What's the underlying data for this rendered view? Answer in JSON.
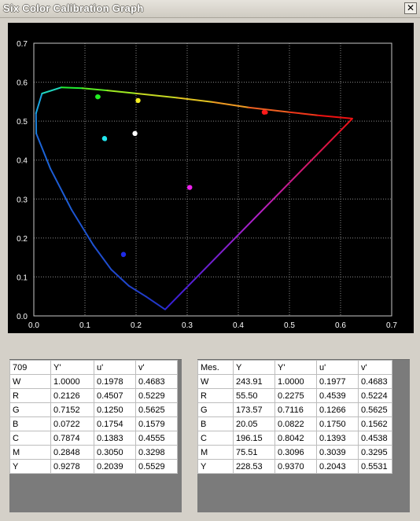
{
  "window": {
    "title": "Six Color Calibration Graph",
    "close_glyph": "✕"
  },
  "chart_data": {
    "type": "scatter",
    "title": "",
    "xlabel": "",
    "ylabel": "",
    "xlim": [
      0.0,
      0.7
    ],
    "ylim": [
      0.0,
      0.7
    ],
    "x_ticks": [
      "0.0",
      "0.1",
      "0.2",
      "0.3",
      "0.4",
      "0.5",
      "0.6",
      "0.7"
    ],
    "y_ticks": [
      "0.0",
      "0.1",
      "0.2",
      "0.3",
      "0.4",
      "0.5",
      "0.6",
      "0.7"
    ],
    "grid": true,
    "background": "#000000",
    "gamut_triangle": {
      "R": [
        0.4507,
        0.5229
      ],
      "G": [
        0.125,
        0.5625
      ],
      "B": [
        0.1754,
        0.1579
      ]
    },
    "spectral_locus": [
      [
        0.2568,
        0.0165
      ],
      [
        0.2196,
        0.0495
      ],
      [
        0.1859,
        0.0771
      ],
      [
        0.1516,
        0.1187
      ],
      [
        0.1165,
        0.1816
      ],
      [
        0.0737,
        0.2729
      ],
      [
        0.0325,
        0.3778
      ],
      [
        0.0048,
        0.4681
      ],
      [
        0.0043,
        0.5203
      ],
      [
        0.016,
        0.5709
      ],
      [
        0.054,
        0.5866
      ],
      [
        0.095,
        0.5845
      ],
      [
        0.1437,
        0.5788
      ],
      [
        0.2,
        0.5711
      ],
      [
        0.28,
        0.56
      ],
      [
        0.35,
        0.549
      ],
      [
        0.42,
        0.535
      ],
      [
        0.5,
        0.523
      ],
      [
        0.555,
        0.515
      ],
      [
        0.623,
        0.5065
      ]
    ],
    "series": [
      {
        "name": "709",
        "points": [
          {
            "label": "W",
            "u": 0.1978,
            "v": 0.4683,
            "color": "#ffffff"
          },
          {
            "label": "R",
            "u": 0.4507,
            "v": 0.5229,
            "color": "#ff1a1a"
          },
          {
            "label": "G",
            "u": 0.125,
            "v": 0.5625,
            "color": "#22ee22"
          },
          {
            "label": "B",
            "u": 0.1754,
            "v": 0.1579,
            "color": "#1f2be6"
          },
          {
            "label": "C",
            "u": 0.1383,
            "v": 0.4555,
            "color": "#22e6ee"
          },
          {
            "label": "M",
            "u": 0.305,
            "v": 0.3298,
            "color": "#ee22ee"
          },
          {
            "label": "Y",
            "u": 0.2039,
            "v": 0.5529,
            "color": "#f4ee22"
          }
        ]
      },
      {
        "name": "Mes.",
        "points": [
          {
            "label": "W",
            "u": 0.1977,
            "v": 0.4683,
            "color": "#ffffff"
          },
          {
            "label": "R",
            "u": 0.4539,
            "v": 0.5224,
            "color": "#ff1a1a"
          },
          {
            "label": "G",
            "u": 0.1266,
            "v": 0.5625,
            "color": "#22ee22"
          },
          {
            "label": "B",
            "u": 0.175,
            "v": 0.1562,
            "color": "#1f2be6"
          },
          {
            "label": "C",
            "u": 0.1393,
            "v": 0.4538,
            "color": "#22e6ee"
          },
          {
            "label": "M",
            "u": 0.3039,
            "v": 0.3295,
            "color": "#ee22ee"
          },
          {
            "label": "Y",
            "u": 0.2043,
            "v": 0.5531,
            "color": "#f4ee22"
          }
        ]
      }
    ]
  },
  "table709": {
    "headers": [
      "709",
      "Y'",
      "u'",
      "v'"
    ],
    "rows": [
      [
        "W",
        "1.0000",
        "0.1978",
        "0.4683"
      ],
      [
        "R",
        "0.2126",
        "0.4507",
        "0.5229"
      ],
      [
        "G",
        "0.7152",
        "0.1250",
        "0.5625"
      ],
      [
        "B",
        "0.0722",
        "0.1754",
        "0.1579"
      ],
      [
        "C",
        "0.7874",
        "0.1383",
        "0.4555"
      ],
      [
        "M",
        "0.2848",
        "0.3050",
        "0.3298"
      ],
      [
        "Y",
        "0.9278",
        "0.2039",
        "0.5529"
      ]
    ]
  },
  "tableMes": {
    "headers": [
      "Mes.",
      "Y",
      "Y'",
      "u'",
      "v'"
    ],
    "rows": [
      [
        "W",
        "243.91",
        "1.0000",
        "0.1977",
        "0.4683"
      ],
      [
        "R",
        "55.50",
        "0.2275",
        "0.4539",
        "0.5224"
      ],
      [
        "G",
        "173.57",
        "0.7116",
        "0.1266",
        "0.5625"
      ],
      [
        "B",
        "20.05",
        "0.0822",
        "0.1750",
        "0.1562"
      ],
      [
        "C",
        "196.15",
        "0.8042",
        "0.1393",
        "0.4538"
      ],
      [
        "M",
        "75.51",
        "0.3096",
        "0.3039",
        "0.3295"
      ],
      [
        "Y",
        "228.53",
        "0.9370",
        "0.2043",
        "0.5531"
      ]
    ]
  }
}
